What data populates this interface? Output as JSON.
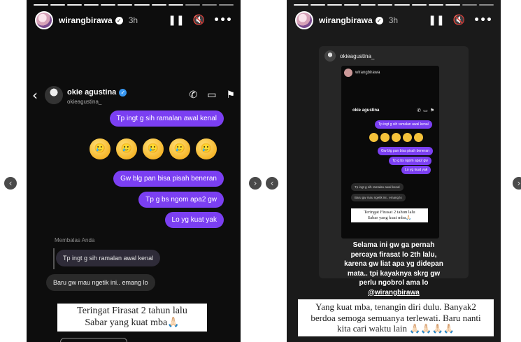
{
  "nav": {
    "prev_icon": "‹",
    "next_icon": "›",
    "prev2_icon": "‹",
    "next2_icon": "›"
  },
  "story_left": {
    "username": "wirangbirawa",
    "time": "3h",
    "chat": {
      "name": "okie agustina",
      "handle": "okieagustina_",
      "bubbles": [
        "Tp ingt g sih ramalan awal kenal",
        "Gw blg pan bisa pisah beneran",
        "Tp g bs ngom apa2 gw",
        "Lo yg kuat yak"
      ],
      "emojis": [
        "🥲",
        "🥲",
        "🥲",
        "🥲",
        "🥲"
      ],
      "reply_label": "Membalas Anda",
      "reply_quote": "Tp ingt g sih ramalan awal kenal",
      "incoming": "Baru gw mau ngetik ini.. emang lo"
    },
    "caption_line1": "Teringat Firasat 2 tahun lalu",
    "caption_line2": "Sabar yang kuat mba🙏🏻"
  },
  "story_right": {
    "username": "wirangbirawa",
    "time": "3h",
    "shared_user": "okieagustina_",
    "inner": {
      "username": "wirangbirawa",
      "chat_name": "okie agustina",
      "bubbles": [
        "Tp ingt g sih ramalan awal kenal",
        "Gw blg pan bisa pisah beneran",
        "Tp g bs ngom apa2 gw",
        "Lo yg kuat yak"
      ],
      "reply_quote": "Tp ingt g sih ramalan awal kenal",
      "incoming": "Baru gw mau ngetik ini.. emang lo",
      "caption_line1": "Teringat Firasat 2 tahun lalu",
      "caption_line2": "Sabar yang kuat mba🙏🏻"
    },
    "text_line1": "Selama ini gw ga pernah",
    "text_line2": "percaya firasat lo 2th lalu,",
    "text_line3": "karena gw liat apa yg didepan",
    "text_line4": "mata.. tpi kayaknya skrg gw",
    "text_line5": "perlu ngobrol ama lo",
    "mention": "@wirangbirawa",
    "caption_line1": "Yang kuat mba, tenangin diri dulu. Banyak2",
    "caption_line2": "berdoa semoga semuanya terlewati. Baru nanti",
    "caption_line3": "kita cari waktu lain 🙏🏻🙏🏻🙏🏻🙏🏻"
  }
}
